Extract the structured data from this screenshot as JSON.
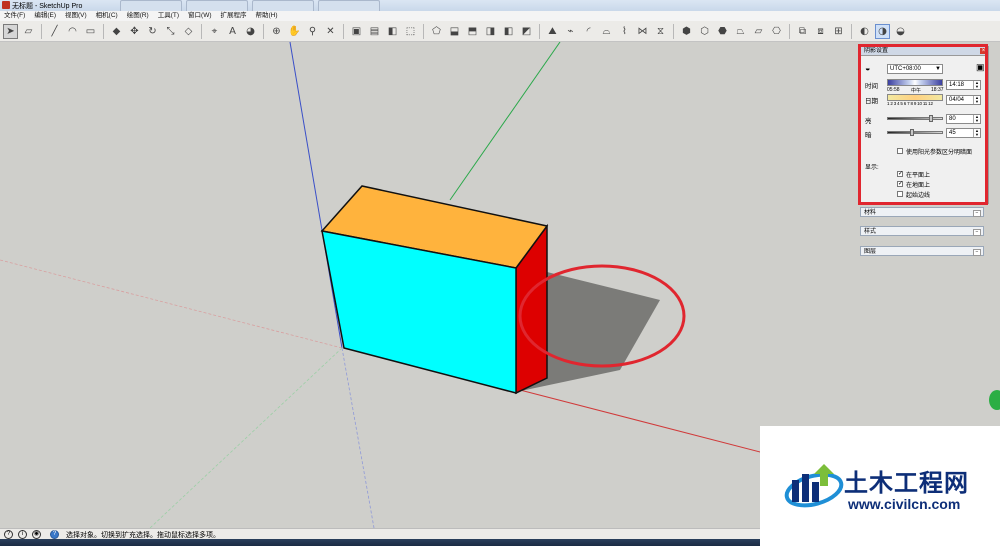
{
  "window": {
    "title": "无标题 - SketchUp Pro"
  },
  "menu": [
    "文件(F)",
    "编辑(E)",
    "视图(V)",
    "相机(C)",
    "绘图(R)",
    "工具(T)",
    "窗口(W)",
    "扩展程序",
    "帮助(H)"
  ],
  "shadow_panel": {
    "title": "阴影设置",
    "timezone": "UTC+08:00",
    "time_label": "时间",
    "time_start": "05:58",
    "time_mid": "中午",
    "time_end": "18:37",
    "time_value": "14:18",
    "date_label": "日期",
    "months": "1 2 3 4 5 6 7 8 9 10 11 12",
    "date_value": "04/04",
    "light_label": "亮",
    "light_value": "80",
    "light_level_percent": 80,
    "dark_label": "暗",
    "dark_value": "45",
    "dark_level_percent": 45,
    "use_sun_label": "使用阳光参数区分明暗面",
    "display_label": "显示:",
    "on_faces_label": "在平面上",
    "on_ground_label": "在地面上",
    "from_edges_label": "起始边线",
    "use_sun_checked": false,
    "on_faces_checked": true,
    "on_ground_checked": true,
    "from_edges_checked": false
  },
  "trays": [
    {
      "label": "材料"
    },
    {
      "label": "样式"
    },
    {
      "label": "图层"
    }
  ],
  "status": {
    "text": "选择对象。切换到扩充选择。拖动鼠标选择多项。"
  },
  "watermark": {
    "title": "土木工程网",
    "url": "www.civilcn.com"
  },
  "colors": {
    "box_front": "#00ffff",
    "box_top": "#ffb33d",
    "box_side": "#dd0000",
    "shadow": "#7b7b78",
    "highlight": "#e0262f",
    "viewport": "#cfcfcb"
  }
}
